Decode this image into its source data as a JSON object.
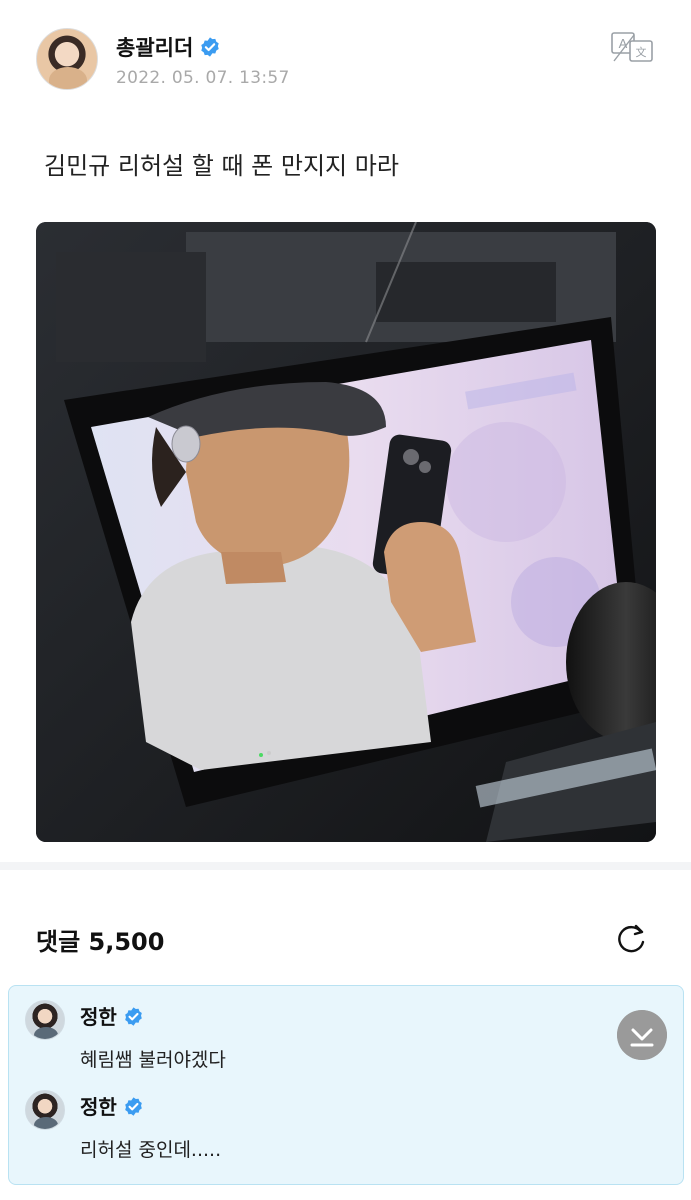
{
  "post": {
    "author": "총괄리더",
    "date": "2022. 05. 07. 13:57",
    "text": "김민규 리허설 할 때 폰 만지지 마라",
    "translate_icon": "translate-icon",
    "verified_icon": "verified-badge-icon"
  },
  "comments": {
    "title": "댓글 5,500",
    "refresh_icon": "refresh-icon",
    "scroll_icon": "scroll-down-icon",
    "items": [
      {
        "author": "정한",
        "text": "혜림쌤 불러야겠다"
      },
      {
        "author": "정한",
        "text": "리허설 중인데....."
      }
    ]
  },
  "colors": {
    "verified": "#3b9cf1",
    "panel_bg": "#e8f6fc",
    "panel_border": "#b9e2f2",
    "date_gray": "#a9a9a9",
    "scroll_btn": "#9a9a9a"
  }
}
